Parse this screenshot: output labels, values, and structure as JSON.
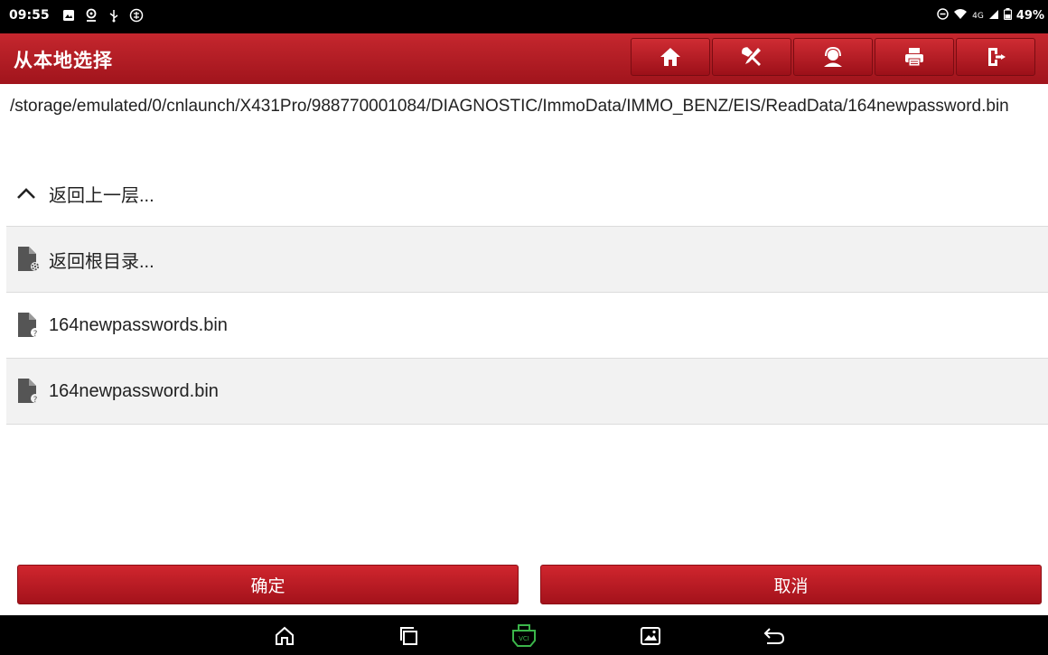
{
  "status_bar": {
    "time": "09:55",
    "network": "4G",
    "battery": "49%"
  },
  "header": {
    "title": "从本地选择",
    "toolbar": [
      "home-icon",
      "tools-icon",
      "support-icon",
      "print-icon",
      "exit-icon"
    ]
  },
  "path": "/storage/emulated/0/cnlaunch/X431Pro/988770001084/DIAGNOSTIC/ImmoData/IMMO_BENZ/EIS/ReadData/164newpassword.bin",
  "list": {
    "items": [
      {
        "label": "返回上一层...",
        "icon": "chevron-up-icon"
      },
      {
        "label": "返回根目录...",
        "icon": "root-folder-icon"
      },
      {
        "label": "164newpasswords.bin",
        "icon": "unknown-file-icon"
      },
      {
        "label": "164newpassword.bin",
        "icon": "unknown-file-icon"
      }
    ]
  },
  "buttons": {
    "ok": "确定",
    "cancel": "取消"
  },
  "nav": [
    "home-icon",
    "recents-icon",
    "vci-icon",
    "gallery-icon",
    "back-icon"
  ],
  "colors": {
    "accent": "#b31c24",
    "vci": "#3bb54a"
  }
}
